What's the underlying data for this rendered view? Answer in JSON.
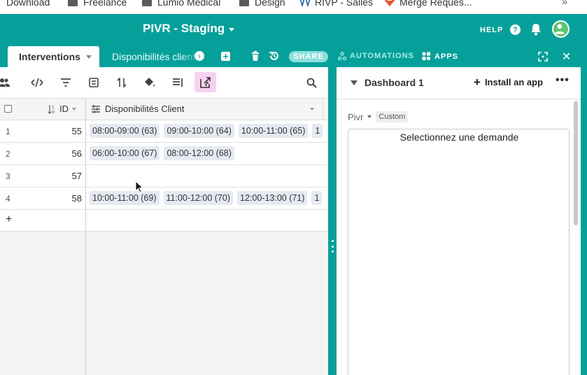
{
  "bookmarks": [
    {
      "label": "Download",
      "kind": "folder"
    },
    {
      "label": "Freelance",
      "kind": "folder"
    },
    {
      "label": "Lumio Medical",
      "kind": "folder"
    },
    {
      "label": "Design",
      "kind": "folder"
    },
    {
      "label": "RIVP - Salles",
      "kind": "favicon"
    },
    {
      "label": "Merge Reques...",
      "kind": "gitlab"
    }
  ],
  "bookmarks_more": "»",
  "base": {
    "title": "PIVR - Staging"
  },
  "topbar": {
    "help_label": "HELP",
    "help_icon": "?"
  },
  "tabs": {
    "active_label": "Interventions",
    "second_label": "Disponibilités client",
    "share_label": "SHARE",
    "automations_label": "AUTOMATIONS",
    "apps_label": "APPS"
  },
  "grid": {
    "columns": {
      "id": "ID",
      "dispo": "Disponibilités Client"
    },
    "rows": [
      {
        "num": "1",
        "id": "55",
        "chips": [
          "08:00-09:00 (63)",
          "09:00-10:00 (64)",
          "10:00-11:00 (65)",
          "1"
        ]
      },
      {
        "num": "2",
        "id": "56",
        "chips": [
          "06:00-10:00 (67)",
          "08:00-12:00 (68)"
        ]
      },
      {
        "num": "3",
        "id": "57",
        "chips": []
      },
      {
        "num": "4",
        "id": "58",
        "chips": [
          "10:00-11:00 (69)",
          "11:00-12:00 (70)",
          "12:00-13:00 (71)",
          "1"
        ]
      }
    ],
    "add_label": "+"
  },
  "dashboard": {
    "title": "Dashboard 1",
    "install_label": "Install an app",
    "more_label": "•••",
    "app_source": "Pivr",
    "app_badge": "Custom",
    "app_message": "Selectionnez une demande"
  },
  "colors": {
    "brand": "#06a09b",
    "chip": "#e5e9f2",
    "active_tool": "#f6d2f0"
  }
}
